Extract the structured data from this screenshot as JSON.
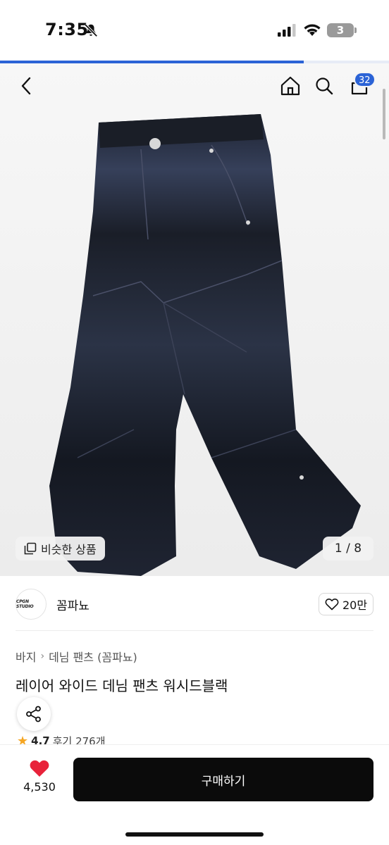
{
  "status_bar": {
    "time": "7:35",
    "battery": "3"
  },
  "load_progress": 0.78,
  "header": {
    "cart_count": "32"
  },
  "gallery": {
    "similar_label": "비슷한 상품",
    "counter": "1 / 8"
  },
  "brand": {
    "logo_text": "CPGN STUDIO",
    "name": "꼼파뇨",
    "likes": "20만"
  },
  "breadcrumb": [
    "바지",
    "데님 팬츠 (꼼파뇨)"
  ],
  "product": {
    "title": "레이어 와이드 데님 팬츠 워시드블랙"
  },
  "rating": {
    "score": "4.7",
    "reviews": "후기 276개"
  },
  "bottom_bar": {
    "like_count": "4,530",
    "buy_label": "구매하기"
  },
  "colors": {
    "accent": "#2b63d6",
    "heart": "#e8223a",
    "star": "#f5a623",
    "button": "#0b0b0b"
  },
  "icons": [
    "bell-slash-icon",
    "signal-icon",
    "wifi-icon",
    "battery-icon",
    "back-arrow-icon",
    "home-icon",
    "search-icon",
    "shopping-bag-icon",
    "similar-items-icon",
    "heart-outline-icon",
    "share-icon",
    "star-icon",
    "heart-filled-icon"
  ]
}
